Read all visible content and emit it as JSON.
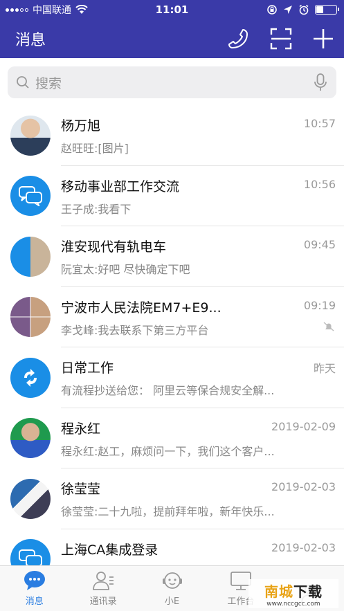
{
  "status_bar": {
    "carrier": "中国联通",
    "time": "11:01"
  },
  "header": {
    "title": "消息",
    "icons": [
      "phone-icon",
      "scan-icon",
      "plus-icon"
    ]
  },
  "search": {
    "placeholder": "搜索"
  },
  "conversations": [
    {
      "name": "杨万旭",
      "preview": "赵旺旺:[图片]",
      "time": "10:57",
      "avatar": "photo"
    },
    {
      "name": "移动事业部工作交流",
      "preview": "王子成:我看下",
      "time": "10:56",
      "avatar": "chat-icon"
    },
    {
      "name": "淮安现代有轨电车",
      "preview": "阮宜太:好吧 尽快确定下吧",
      "time": "09:45",
      "avatar": "group-photo"
    },
    {
      "name": "宁波市人民法院EM7+E9...",
      "preview": "李戈峰:我去联系下第三方平台",
      "time": "09:19",
      "avatar": "group-grid",
      "muted": true
    },
    {
      "name": "日常工作",
      "preview": "有流程抄送给您： 阿里云等保合规安全解...",
      "time": "昨天",
      "avatar": "workflow-icon"
    },
    {
      "name": "程永红",
      "preview": "程永红:赵工，麻烦问一下，我们这个客户...",
      "time": "2019-02-09",
      "avatar": "photo"
    },
    {
      "name": "徐莹莹",
      "preview": "徐莹莹:二十九啦，提前拜年啦，新年快乐...",
      "time": "2019-02-03",
      "avatar": "photo"
    },
    {
      "name": "上海CA集成登录",
      "preview": "",
      "time": "2019-02-03",
      "avatar": "chat-icon"
    }
  ],
  "tabs": [
    {
      "label": "消息",
      "active": true
    },
    {
      "label": "通讯录",
      "active": false
    },
    {
      "label": "小E",
      "active": false
    },
    {
      "label": "工作台",
      "active": false
    },
    {
      "label": "",
      "active": false
    }
  ],
  "watermark": {
    "main_a": "南城",
    "main_b": "下载",
    "sub": "www.nccgcc.com"
  },
  "colors": {
    "header_bg": "#3a3aa8",
    "accent": "#1a8ee6",
    "active_tab": "#2a7de1"
  }
}
